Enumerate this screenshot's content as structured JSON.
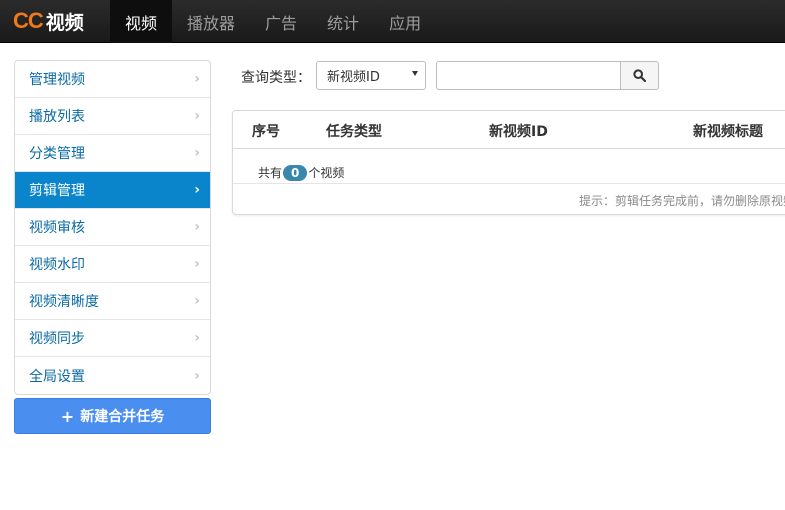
{
  "brand": {
    "logo_cc": "CC",
    "logo_text": "视频"
  },
  "nav": {
    "items": [
      {
        "label": "视频",
        "active": true
      },
      {
        "label": "播放器",
        "active": false
      },
      {
        "label": "广告",
        "active": false
      },
      {
        "label": "统计",
        "active": false
      },
      {
        "label": "应用",
        "active": false
      }
    ]
  },
  "sidebar": {
    "items": [
      {
        "label": "管理视频",
        "active": false
      },
      {
        "label": "播放列表",
        "active": false
      },
      {
        "label": "分类管理",
        "active": false
      },
      {
        "label": "剪辑管理",
        "active": true
      },
      {
        "label": "视频审核",
        "active": false
      },
      {
        "label": "视频水印",
        "active": false
      },
      {
        "label": "视频清晰度",
        "active": false
      },
      {
        "label": "视频同步",
        "active": false
      },
      {
        "label": "全局设置",
        "active": false
      }
    ],
    "new_task_label": "新建合并任务"
  },
  "query": {
    "label": "查询类型：",
    "type_selected": "新视频ID",
    "input_value": "",
    "input_placeholder": ""
  },
  "table": {
    "columns": [
      "序号",
      "任务类型",
      "新视频ID",
      "新视频标题"
    ],
    "count_prefix": "共有",
    "count": "0",
    "count_suffix": "个视频",
    "hint": "提示：剪辑任务完成前，请勿删除原视频"
  },
  "colors": {
    "brand_accent": "#f07a1a",
    "sidebar_active": "#0a85cc",
    "sidebar_link": "#0b6aa3",
    "primary_button": "#4a8ff0",
    "badge": "#3a87ad"
  }
}
